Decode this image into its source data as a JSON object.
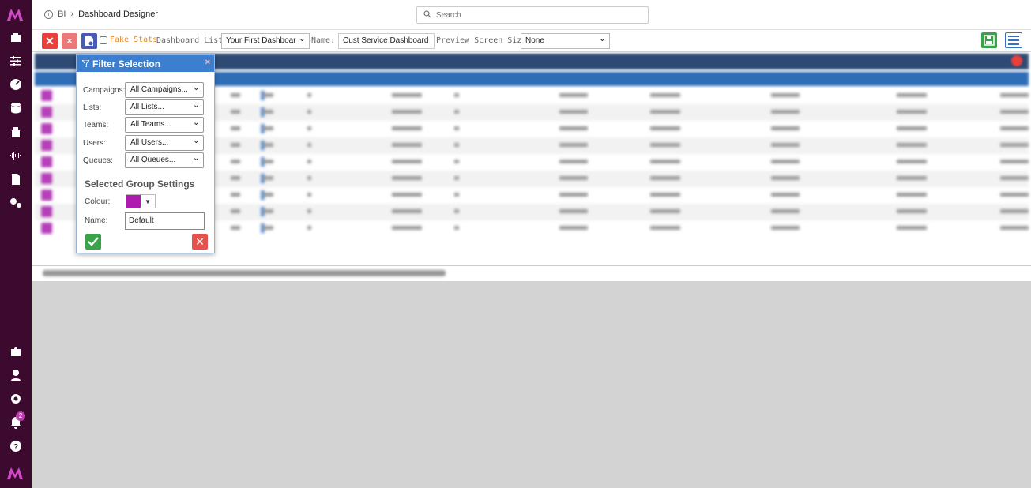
{
  "app": {
    "brand_color": "#3c0a2f",
    "accent": "#c13ab2"
  },
  "sidebar": {
    "icons": [
      "logo-icon",
      "briefcase-icon",
      "sliders-icon",
      "dashboard-gauge-icon",
      "database-icon",
      "cloud-data-icon",
      "waveform-icon",
      "report-doc-icon",
      "cogs-icon",
      "puzzle-icon",
      "user-support-icon",
      "settings-gear-icon",
      "bell-icon",
      "help-icon",
      "brand-footer-icon"
    ],
    "notification_count": "2"
  },
  "header": {
    "breadcrumb_root": "BI",
    "breadcrumb_sep": "›",
    "title": "Dashboard Designer",
    "search_placeholder": "Search"
  },
  "toolbar": {
    "fake_stats_label": "Fake Stats",
    "fake_stats_checked": false,
    "dashboard_list_label": "Dashboard List:",
    "dashboard_list_value": "Your First Dashboar",
    "name_label": "Name:",
    "name_value": "Cust Service Dashboard",
    "preview_label": "Preview Screen Size:",
    "preview_value": "None"
  },
  "filter_popup": {
    "title": "Filter Selection",
    "close": "×",
    "filters": [
      {
        "label": "Campaigns:",
        "value": "All Campaigns..."
      },
      {
        "label": "Lists:",
        "value": "All Lists..."
      },
      {
        "label": "Teams:",
        "value": "All Teams..."
      },
      {
        "label": "Users:",
        "value": "All Users..."
      },
      {
        "label": "Queues:",
        "value": "All Queues..."
      }
    ],
    "group_settings_title": "Selected Group Settings",
    "colour_label": "Colour:",
    "colour_value": "#b01ab0",
    "colour_arrow": "▼",
    "name_label": "Name:",
    "name_value": "Default"
  }
}
